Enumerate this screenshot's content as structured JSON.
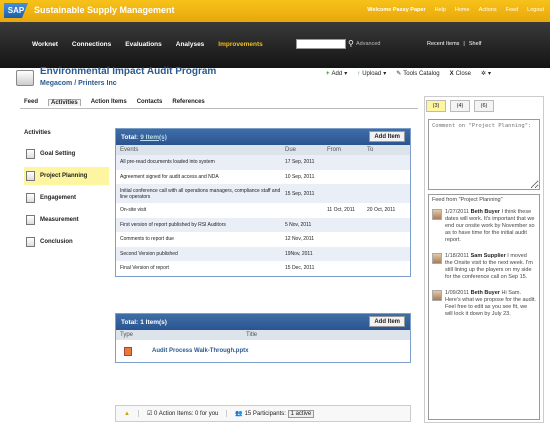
{
  "app": {
    "logo": "SAP",
    "title": "Sustainable Supply Management"
  },
  "userlinks": [
    "Welcome Passy Paper",
    "Help",
    "Home",
    "Actions",
    "Feed",
    "Logout"
  ],
  "nav": {
    "items": [
      "Worknet",
      "Connections",
      "Evaluations",
      "Analyses",
      "Improvements"
    ],
    "active": 4,
    "search_placeholder": "",
    "advanced": "Advanced",
    "recent": "Recent Items",
    "shelf": "Shelf"
  },
  "program": {
    "title": "Environmental Impact Audit Program",
    "subtitle": "Megacom / Printers Inc"
  },
  "actions": {
    "add": "Add",
    "upload": "Upload",
    "tools": "Tools Catalog",
    "close": "Close"
  },
  "tabs": [
    "Feed",
    "Activities",
    "Action Items",
    "Contacts",
    "References"
  ],
  "sidebar": {
    "heading": "Activities",
    "items": [
      "Goal Setting",
      "Project Planning",
      "Engagement",
      "Measurement",
      "Conclusion"
    ],
    "selected": 1
  },
  "events_panel": {
    "total_label": "Total:",
    "count": "9 Item(s)",
    "add": "Add Item",
    "columns": [
      "Events",
      "Due",
      "From",
      "To"
    ],
    "rows": [
      [
        "All pre-read documents loaded into system",
        "17 Sep, 2011",
        "",
        ""
      ],
      [
        "Agreement signed for audit access and NDA",
        "10 Sep, 2011",
        "",
        ""
      ],
      [
        "Initial conference call with all operations managers, compliance staff and line operators",
        "15 Sep, 2011",
        "",
        ""
      ],
      [
        "On-site visit",
        "",
        "11 Oct, 2011",
        "20 Oct, 2011"
      ],
      [
        "First version of report published by RSI Auditors",
        "5 Nov, 2011",
        "",
        ""
      ],
      [
        "Comments to report due",
        "12 Nov, 2011",
        "",
        ""
      ],
      [
        "Second Version published",
        "19Nov, 2011",
        "",
        ""
      ],
      [
        "Final Version of report",
        "15 Dec, 2011",
        "",
        ""
      ]
    ]
  },
  "items_panel": {
    "total_label": "Total:",
    "count": "1 Item(s)",
    "add": "Add Item",
    "columns": [
      "Type",
      "Title"
    ],
    "file": "Audit Process Walk-Through.pptx"
  },
  "footer": {
    "actions": "0 Action Items:",
    "for_you": "0 for you",
    "participants": "15 Participants:",
    "active": "1 active"
  },
  "right": {
    "tabs": [
      "(3)",
      "(4)",
      "(6)"
    ],
    "comment": "Comment on \"Project Planning\":",
    "feed_title": "Feed from \"Project Planning\"",
    "feed": [
      {
        "date": "1/27/2011",
        "who": "Beth Buyer",
        "text": "I think these dates will work. It's important that we end our onsite work by November so as to have time for the initial audit report."
      },
      {
        "date": "1/18/2011",
        "who": "Sam Supplier",
        "text": "I moved the Onsite visit to the next week. I'm still lining up the players on my side for the conference call on Sep 15."
      },
      {
        "date": "1/09/2011",
        "who": "Beth Buyer",
        "text": "Hi Sam. Here's what we propose for the audit. Feel free to edit as you see fit, we will lock it down by July 23."
      }
    ]
  }
}
